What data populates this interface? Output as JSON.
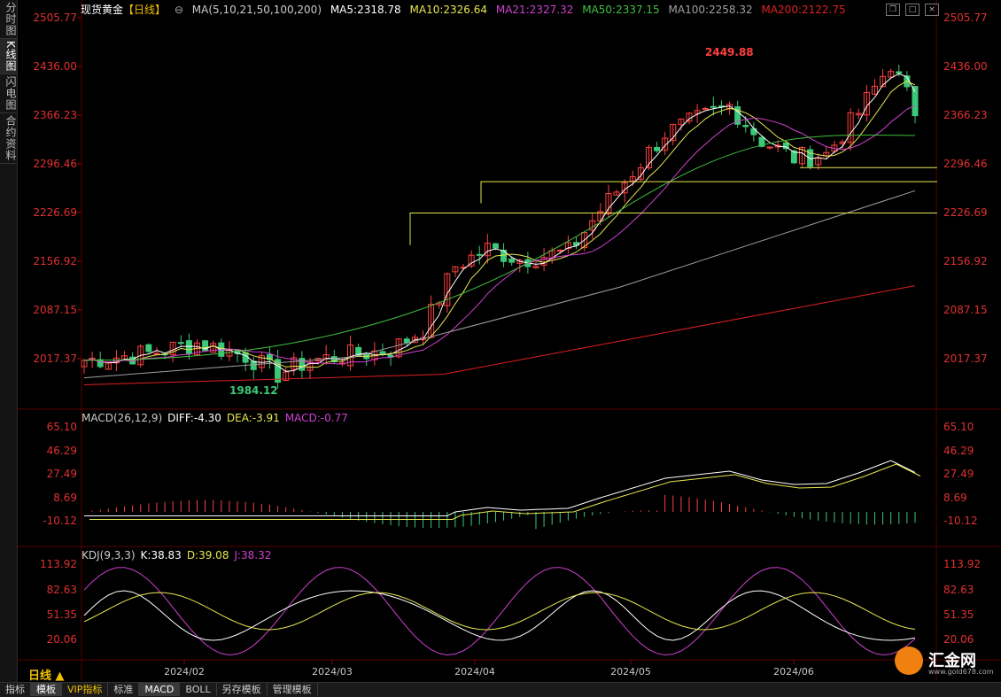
{
  "left_tabs": [
    "分时图",
    "K线图",
    "闪电图",
    "合约资料"
  ],
  "header": {
    "symbol": "现货黄金",
    "period_tag": "【日线】",
    "ma_label": "MA(5,10,21,50,100,200)",
    "ma5": "MA5:2318.78",
    "ma10": "MA10:2326.64",
    "ma21": "MA21:2327.32",
    "ma50": "MA50:2337.15",
    "ma100": "MA100:2258.32",
    "ma200": "MA200:2122.75"
  },
  "macd_header": {
    "label": "MACD(26,12,9)",
    "diff": "DIFF:-4.30",
    "dea": "DEA:-3.91",
    "macd": "MACD:-0.77"
  },
  "kdj_header": {
    "label": "KDJ(9,3,3)",
    "k": "K:38.83",
    "d": "D:39.08",
    "j": "J:38.32"
  },
  "price_axis": [
    "2505.77",
    "2436.00",
    "2366.23",
    "2296.46",
    "2226.69",
    "2156.92",
    "2087.15",
    "2017.37"
  ],
  "macd_axis": [
    "65.10",
    "46.29",
    "27.49",
    "8.69",
    "-10.12"
  ],
  "kdj_axis": [
    "113.92",
    "82.63",
    "51.35",
    "20.06"
  ],
  "annotations": {
    "high": "2449.88",
    "low": "1984.12"
  },
  "x_labels": [
    "2024/02",
    "2024/03",
    "2024/04",
    "2024/05",
    "2024/06"
  ],
  "period_label": "日线",
  "bottom_tabs": [
    "指标",
    "模板",
    "VIP指标",
    "标准",
    "MACD",
    "BOLL",
    "另存模板",
    "管理模板"
  ],
  "logo": {
    "name": "汇金网",
    "url": "www.gold678.com"
  },
  "colors": {
    "up": "#ff4040",
    "down": "#3cc878",
    "ma5": "#ffffff",
    "ma10": "#e6e650",
    "ma21": "#d040d0",
    "ma50": "#40c040",
    "ma100": "#a0a0a0",
    "ma200": "#e02020"
  }
}
